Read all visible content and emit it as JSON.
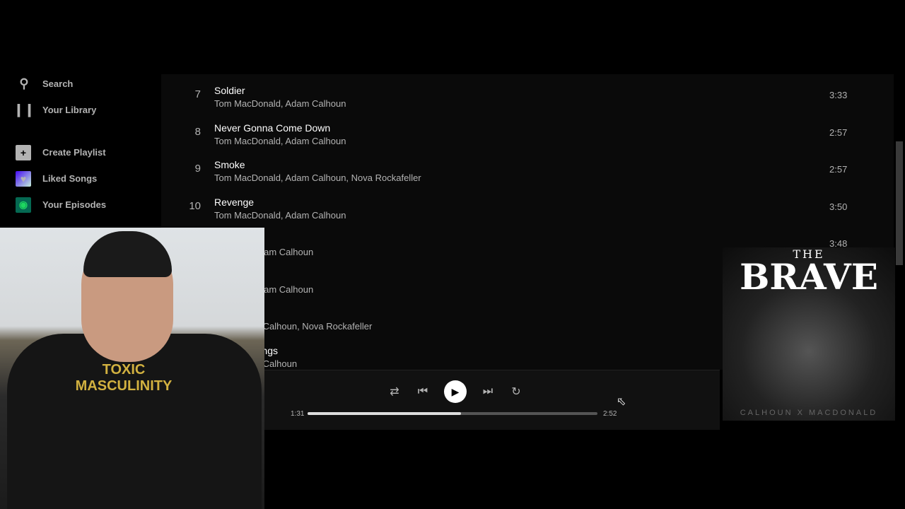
{
  "sidebar": {
    "items": [
      {
        "label": "Search",
        "icon": "search-icon"
      },
      {
        "label": "Your Library",
        "icon": "library-icon"
      },
      {
        "label": "Create Playlist",
        "icon": "plus-icon"
      },
      {
        "label": "Liked Songs",
        "icon": "heart-icon"
      },
      {
        "label": "Your Episodes",
        "icon": "podcast-icon"
      }
    ]
  },
  "tracks": [
    {
      "num": "7",
      "title": "Soldier",
      "artists": "Tom MacDonald, Adam Calhoun",
      "duration": "3:33"
    },
    {
      "num": "8",
      "title": "Never Gonna Come Down",
      "artists": "Tom MacDonald, Adam Calhoun",
      "duration": "2:57"
    },
    {
      "num": "9",
      "title": "Smoke",
      "artists": "Tom MacDonald, Adam Calhoun, Nova Rockafeller",
      "duration": "2:57"
    },
    {
      "num": "10",
      "title": "Revenge",
      "artists": "Tom MacDonald, Adam Calhoun",
      "duration": "3:50"
    },
    {
      "num": "",
      "title": "",
      "artists": "cDonald, Adam Calhoun",
      "duration": "3:48"
    },
    {
      "num": "",
      "title": "d",
      "artists": "cDonald, Adam Calhoun",
      "duration": ""
    },
    {
      "num": "",
      "title": "",
      "artists": "nald, Adam Calhoun, Nova Rockafeller",
      "duration": ""
    },
    {
      "num": "",
      "title": "t Some Things",
      "artists": "nald, Adam Calhoun",
      "duration": ""
    }
  ],
  "player": {
    "elapsed": "1:31",
    "total": "2:52",
    "progress": 0.53
  },
  "album_art": {
    "line1": "THE",
    "line2": "BRAVE",
    "line3": "CALHOUN X MACDONALD"
  },
  "webcam": {
    "shirt_text": "TOXIC MASCULINITY"
  },
  "colors": {
    "accent": "#1db954",
    "background": "#000000"
  }
}
